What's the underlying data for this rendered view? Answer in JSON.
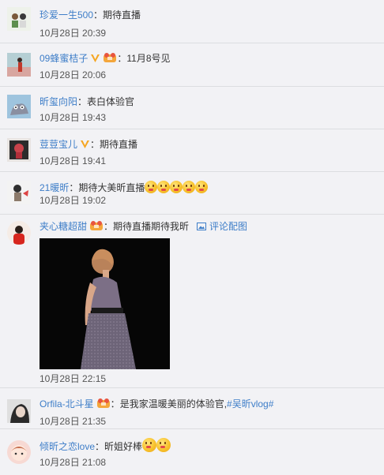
{
  "comments": [
    {
      "user": "珍爱一生500",
      "text": "期待直播",
      "time": "10月28日 20:39"
    },
    {
      "user": "09蜂蜜桔子",
      "text": "11月8号见",
      "time": "10月28日 20:06"
    },
    {
      "user": "昕玺向阳",
      "text": "表白体验官",
      "time": "10月28日 19:43"
    },
    {
      "user": "荳荳宝儿",
      "text": "期待直播",
      "time": "10月28日 19:41"
    },
    {
      "user": "21暖昕",
      "text": "期待大美昕直播",
      "time": "10月28日 19:02"
    },
    {
      "user": "夹心糖超甜",
      "text": "期待直播期待我昕",
      "time": "10月28日 22:15",
      "pic_link": "评论配图"
    },
    {
      "user": "Orfila-北斗星",
      "text": "是我家温暖美丽的体验官,",
      "tag": "#吴昕vlog#",
      "time": "10月28日 21:35"
    },
    {
      "user": "倾昕之恋love",
      "text": "昕姐好棒",
      "time": "10月28日 21:08"
    }
  ],
  "colors": {
    "link": "#3d7dc8",
    "background": "#f2f2f5",
    "divider": "#dcdde0",
    "verified": "#f5a623"
  },
  "icons": [
    "verified-badge-icon",
    "member-badge-icon",
    "picture-icon",
    "emoji-icon"
  ]
}
